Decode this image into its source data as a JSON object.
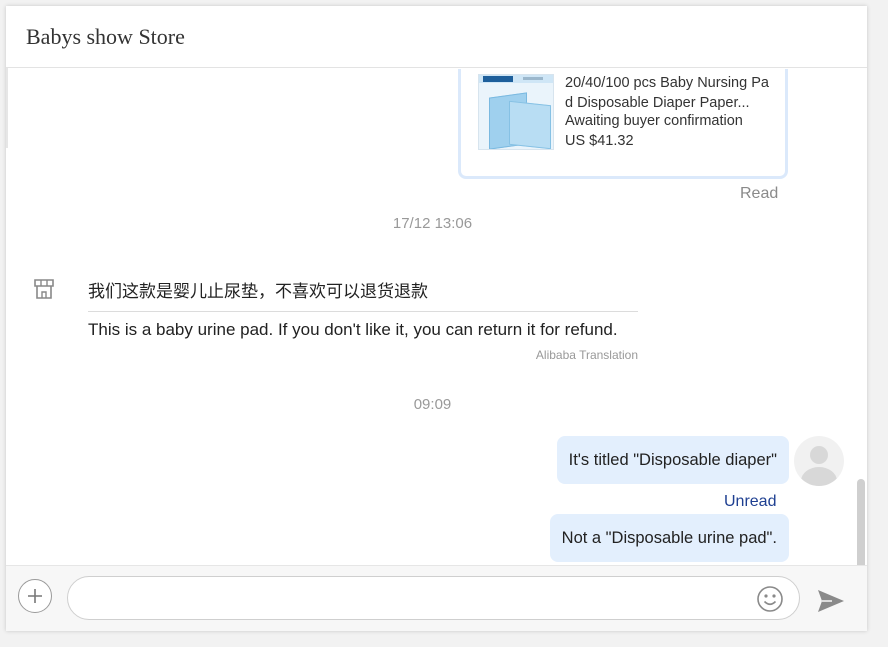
{
  "header": {
    "store_name": "Babys show Store"
  },
  "product_card": {
    "title": "20/40/100 pcs Baby Nursing Pad Disposable Diaper Paper...",
    "status": "Awaiting buyer confirmation",
    "price": "US $41.32",
    "read_status": "Read"
  },
  "messages": {
    "timestamp_1": "17/12 13:06",
    "incoming": {
      "original": "我们这款是婴儿止尿垫，不喜欢可以退货退款",
      "translation": "This is a baby urine pad. If you don't like it, you can return it for refund.",
      "translator": "Alibaba Translation"
    },
    "timestamp_2": "09:09",
    "outgoing_1": "It's titled \"Disposable diaper\"",
    "outgoing_1_status": "Unread",
    "outgoing_2": "Not a \"Disposable urine pad\"."
  },
  "composer": {
    "placeholder": "",
    "value": ""
  },
  "icons": {
    "store": "store-icon",
    "add": "plus-circle-icon",
    "emoji": "smiley-icon",
    "send": "send-arrow-icon",
    "avatar": "user-avatar-icon"
  },
  "colors": {
    "bubble": "#e3effd",
    "unread": "#1e3f91",
    "card_border": "#dbe9fb"
  }
}
